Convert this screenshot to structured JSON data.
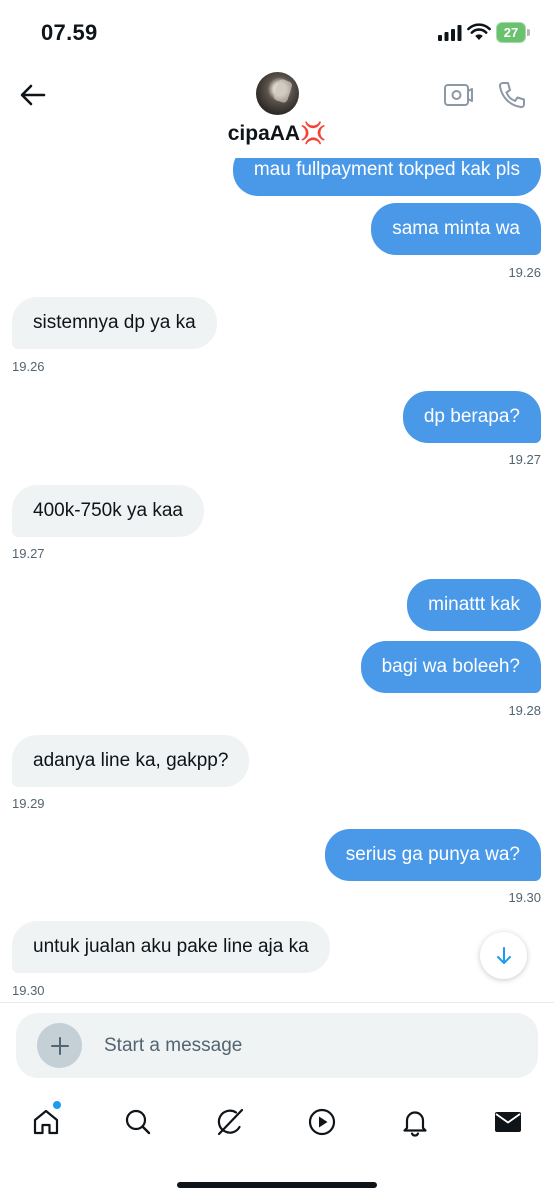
{
  "status_bar": {
    "time": "07.59",
    "battery": "27"
  },
  "header": {
    "contact_name": "cipaAA💢"
  },
  "messages": [
    {
      "text": "mau fullpayment tokped kak pls",
      "direction": "out",
      "time": ""
    },
    {
      "text": "sama minta wa",
      "direction": "out",
      "time": "19.26"
    },
    {
      "text": "sistemnya dp ya ka",
      "direction": "in",
      "time": "19.26"
    },
    {
      "text": "dp berapa?",
      "direction": "out",
      "time": "19.27"
    },
    {
      "text": "400k-750k ya kaa",
      "direction": "in",
      "time": "19.27"
    },
    {
      "text": "minattt kak",
      "direction": "out",
      "time": ""
    },
    {
      "text": "bagi wa boleeh?",
      "direction": "out",
      "time": "19.28"
    },
    {
      "text": "adanya line ka, gakpp?",
      "direction": "in",
      "time": "19.29"
    },
    {
      "text": "serius ga punya wa?",
      "direction": "out",
      "time": "19.30"
    },
    {
      "text": "untuk jualan aku pake line aja ka",
      "direction": "in",
      "time": "19.30"
    }
  ],
  "composer": {
    "placeholder": "Start a message"
  },
  "tabs": [
    "home-icon",
    "search-icon",
    "grok-icon",
    "video-icon",
    "notifications-icon",
    "messages-icon"
  ],
  "colors": {
    "outgoing_bubble": "#4a99e9",
    "incoming_bubble": "#eff3f4",
    "accent": "#1d9bf0"
  }
}
